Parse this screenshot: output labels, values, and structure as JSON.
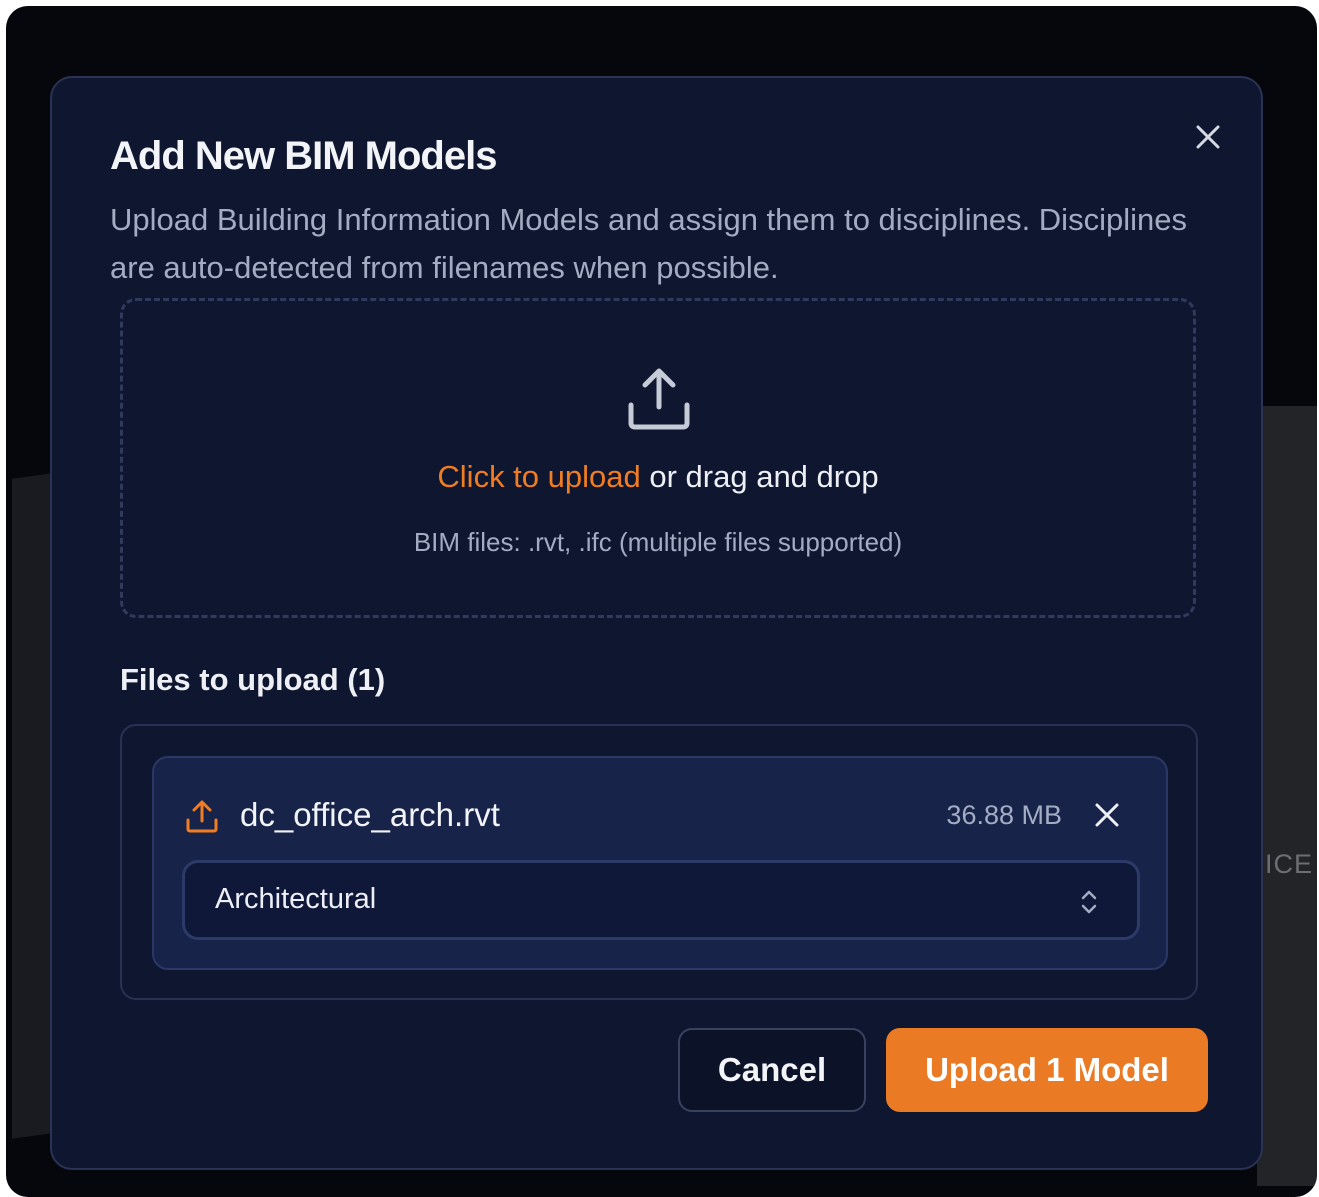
{
  "dialog": {
    "title": "Add New BIM Models",
    "description": "Upload Building Information Models and assign them to disciplines. Disciplines are auto-detected from filenames when possible."
  },
  "background": {
    "partial_label": "FICE"
  },
  "dropzone": {
    "link_text": "Click to upload",
    "rest_text": " or drag and drop",
    "hint": "BIM files: .rvt, .ifc (multiple files supported)",
    "icon": "upload-icon"
  },
  "files": {
    "heading": "Files to upload (1)",
    "items": [
      {
        "name": "dc_office_arch.rvt",
        "size": "36.88 MB",
        "discipline": "Architectural",
        "icon": "upload-icon"
      }
    ]
  },
  "actions": {
    "cancel_label": "Cancel",
    "upload_label": "Upload 1 Model"
  },
  "colors": {
    "accent": "#ea7a24",
    "modal_bg": "#0f1630",
    "text_primary": "#f2f4f8",
    "text_muted": "#a3acc2"
  }
}
